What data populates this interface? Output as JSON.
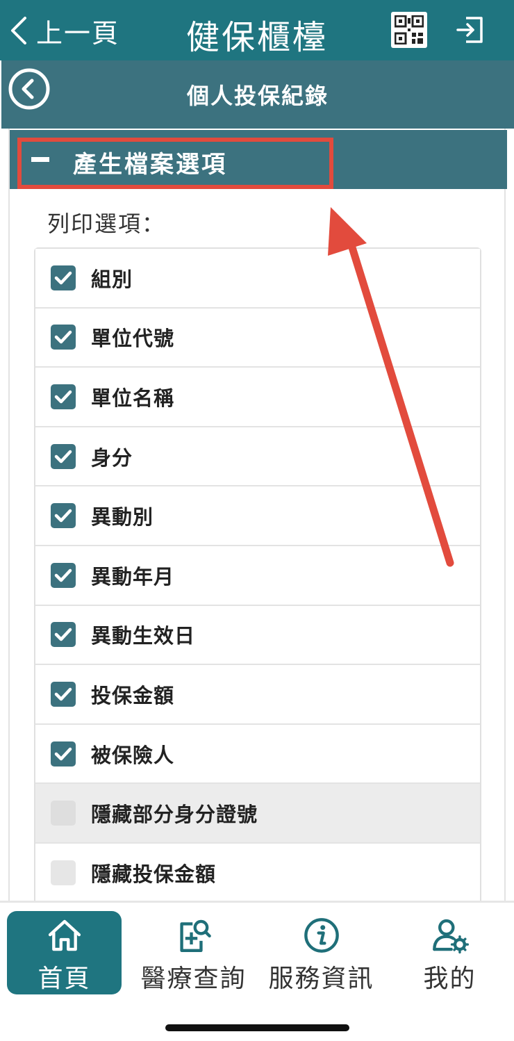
{
  "topbar": {
    "back_label": "上一頁",
    "app_title": "健保櫃檯",
    "background": "#1f7580"
  },
  "subbar": {
    "title": "個人投保紀錄",
    "background": "#3c727f"
  },
  "section": {
    "title": "產生檔案選項",
    "expanded": true,
    "highlight_color": "#e24b3d"
  },
  "print_options": {
    "label": "列印選項：",
    "items": [
      {
        "label": "組別",
        "checked": true
      },
      {
        "label": "單位代號",
        "checked": true
      },
      {
        "label": "單位名稱",
        "checked": true
      },
      {
        "label": "身分",
        "checked": true
      },
      {
        "label": "異動別",
        "checked": true
      },
      {
        "label": "異動年月",
        "checked": true
      },
      {
        "label": "異動生效日",
        "checked": true
      },
      {
        "label": "投保金額",
        "checked": true
      },
      {
        "label": "被保險人",
        "checked": true
      },
      {
        "label": "隱藏部分身分證號",
        "checked": false
      },
      {
        "label": "隱藏投保金額",
        "checked": false
      }
    ]
  },
  "bottom_nav": {
    "items": [
      {
        "label": "首頁",
        "icon": "home-icon",
        "active": true
      },
      {
        "label": "醫療查詢",
        "icon": "medical-search-icon",
        "active": false
      },
      {
        "label": "服務資訊",
        "icon": "info-icon",
        "active": false
      },
      {
        "label": "我的",
        "icon": "user-settings-icon",
        "active": false
      }
    ]
  }
}
